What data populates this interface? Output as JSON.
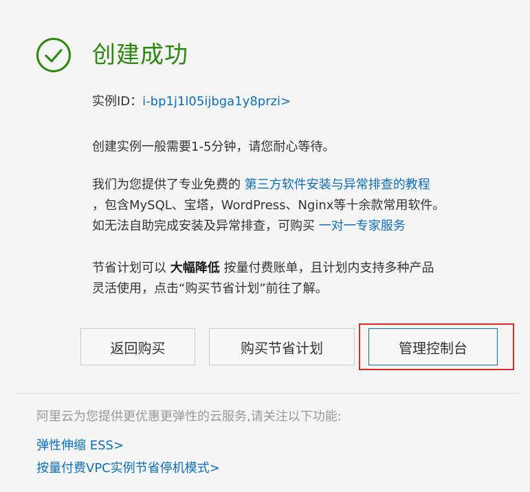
{
  "header": {
    "title": "创建成功",
    "icon": "check-circle-icon",
    "success_color": "#2a8a0d"
  },
  "instance": {
    "label": "实例ID：",
    "id_link": "i-bp1j1l05ijbga1y8przi>"
  },
  "messages": {
    "wait_text": "创建实例一般需要1-5分钟，请您耐心等待。",
    "tutorial_prefix": "我们为您提供了专业免费的 ",
    "tutorial_link": "第三方软件安装与异常排查的教程",
    "tutorial_line2": "，包含MySQL、宝塔，WordPress、Nginx等十余款常用软件。",
    "expert_prefix": "如无法自助完成安装及异常排查，可购买 ",
    "expert_link": "一对一专家服务",
    "plan_prefix": "节省计划可以 ",
    "plan_bold": "大幅降低",
    "plan_suffix": " 按量付费账单，且计划内支持多种产品",
    "plan_line2": "灵活使用，点击“购买节省计划”前往了解。"
  },
  "buttons": {
    "back": "返回购买",
    "buy_plan": "购买节省计划",
    "console": "管理控制台"
  },
  "footer": {
    "note": "阿里云为您提供更优惠更弹性的云服务,请关注以下功能:",
    "links": [
      "弹性伸缩 ESS>",
      "按量付费VPC实例节省停机模式>"
    ]
  },
  "colors": {
    "link": "#0a6fc2",
    "highlight": "#e3271e",
    "muted_text": "#999999"
  }
}
